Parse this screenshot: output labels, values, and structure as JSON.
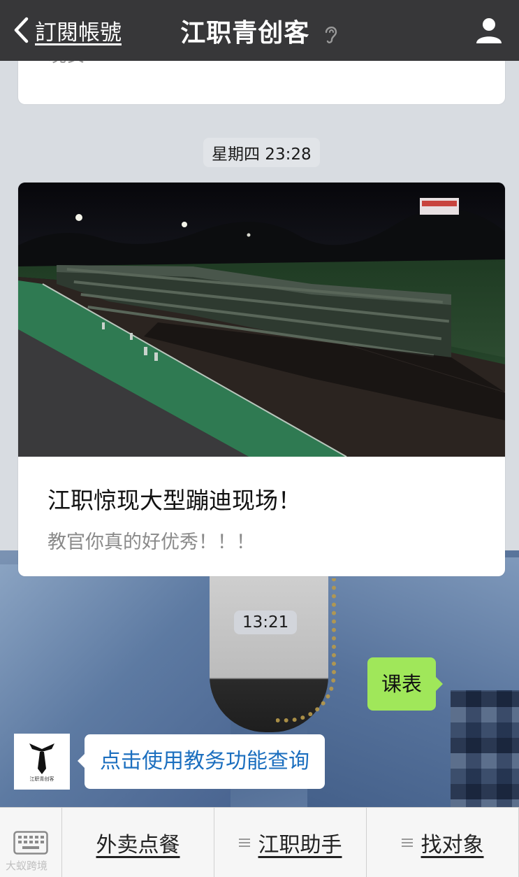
{
  "topbar": {
    "back_label": "訂閱帳號",
    "title": "江职青创客"
  },
  "chat": {
    "prev_card_text": "晚安",
    "timestamp_1": "星期四 23:28",
    "article": {
      "title": "江职惊现大型蹦迪现场！",
      "description": "教官你真的好优秀！！！"
    },
    "timestamp_2": "13:21",
    "sent_message": "课表",
    "avatar_label": "江职青创客",
    "received_message": "点击使用教务功能查询"
  },
  "menu": {
    "items": [
      {
        "label": "外卖点餐"
      },
      {
        "label": "江职助手"
      },
      {
        "label": "找对象"
      }
    ]
  },
  "watermark": "大蚁跨境",
  "colors": {
    "topbar": "#373739",
    "sent_bubble": "#a0e75a",
    "link_text": "#1c6fbf"
  }
}
